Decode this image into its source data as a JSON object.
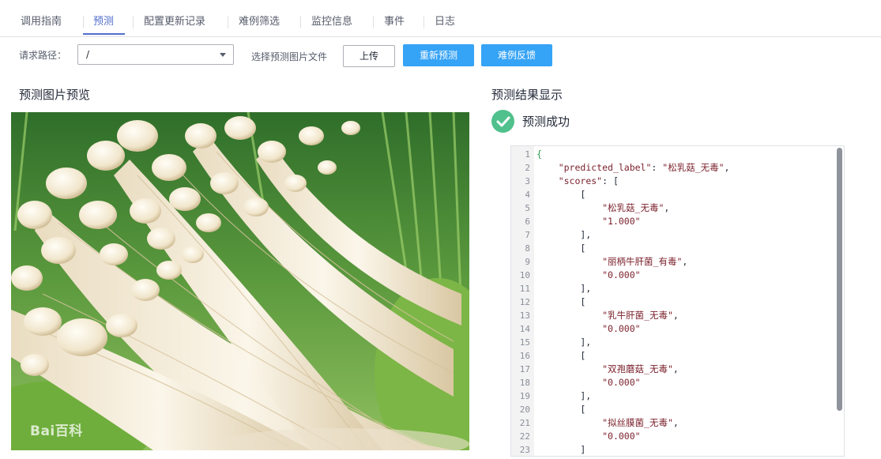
{
  "tabs": [
    {
      "label": "调用指南"
    },
    {
      "label": "预测"
    },
    {
      "label": "配置更新记录"
    },
    {
      "label": "难例筛选"
    },
    {
      "label": "监控信息"
    },
    {
      "label": "事件"
    },
    {
      "label": "日志"
    }
  ],
  "toolbar": {
    "path_label": "请求路径：",
    "path_value": "/",
    "file_label": "选择预测图片文件",
    "upload": "上传",
    "repredict": "重新预测",
    "feedback": "难例反馈"
  },
  "preview": {
    "title": "预测图片预览",
    "watermark": "Bai百科"
  },
  "result": {
    "title": "预测结果显示",
    "status": "预测成功"
  },
  "code_lines": [
    {
      "n": "1",
      "t": "{"
    },
    {
      "n": "2",
      "t": "    \"predicted_label\": \"松乳菇_无毒\","
    },
    {
      "n": "3",
      "t": "    \"scores\": ["
    },
    {
      "n": "4",
      "t": "        ["
    },
    {
      "n": "5",
      "t": "            \"松乳菇_无毒\","
    },
    {
      "n": "6",
      "t": "            \"1.000\""
    },
    {
      "n": "7",
      "t": "        ],"
    },
    {
      "n": "8",
      "t": "        ["
    },
    {
      "n": "9",
      "t": "            \"丽柄牛肝菌_有毒\","
    },
    {
      "n": "10",
      "t": "            \"0.000\""
    },
    {
      "n": "11",
      "t": "        ],"
    },
    {
      "n": "12",
      "t": "        ["
    },
    {
      "n": "13",
      "t": "            \"乳牛肝菌_无毒\","
    },
    {
      "n": "14",
      "t": "            \"0.000\""
    },
    {
      "n": "15",
      "t": "        ],"
    },
    {
      "n": "16",
      "t": "        ["
    },
    {
      "n": "17",
      "t": "            \"双孢蘑菇_无毒\","
    },
    {
      "n": "18",
      "t": "            \"0.000\""
    },
    {
      "n": "19",
      "t": "        ],"
    },
    {
      "n": "20",
      "t": "        ["
    },
    {
      "n": "21",
      "t": "            \"拟丝膜菌_无毒\","
    },
    {
      "n": "22",
      "t": "            \"0.000\""
    },
    {
      "n": "23",
      "t": "        ]"
    }
  ]
}
